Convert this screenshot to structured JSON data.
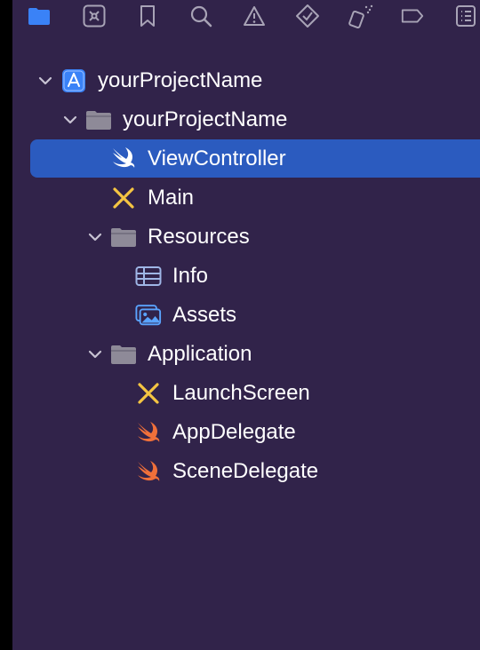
{
  "toolbar": {
    "icons": [
      "folder-icon",
      "source-control-icon",
      "bookmark-icon",
      "search-icon",
      "warning-icon",
      "test-diamond-icon",
      "debug-spray-icon",
      "breakpoint-icon",
      "report-list-icon"
    ],
    "active_color": "#3a82f7",
    "inactive_color": "#a8a3b6"
  },
  "tree": {
    "project": "yourProjectName",
    "group": "yourProjectName",
    "items": {
      "view_controller": "ViewController",
      "main": "Main",
      "resources": "Resources",
      "info": "Info",
      "assets": "Assets",
      "application": "Application",
      "launch_screen": "LaunchScreen",
      "app_delegate": "AppDelegate",
      "scene_delegate": "SceneDelegate"
    }
  },
  "colors": {
    "background": "#31234a",
    "selection": "#2b5bbf",
    "swift_orange": "#f0703a",
    "storyboard_yellow": "#f5c542",
    "folder_gray": "#8e8a98"
  }
}
